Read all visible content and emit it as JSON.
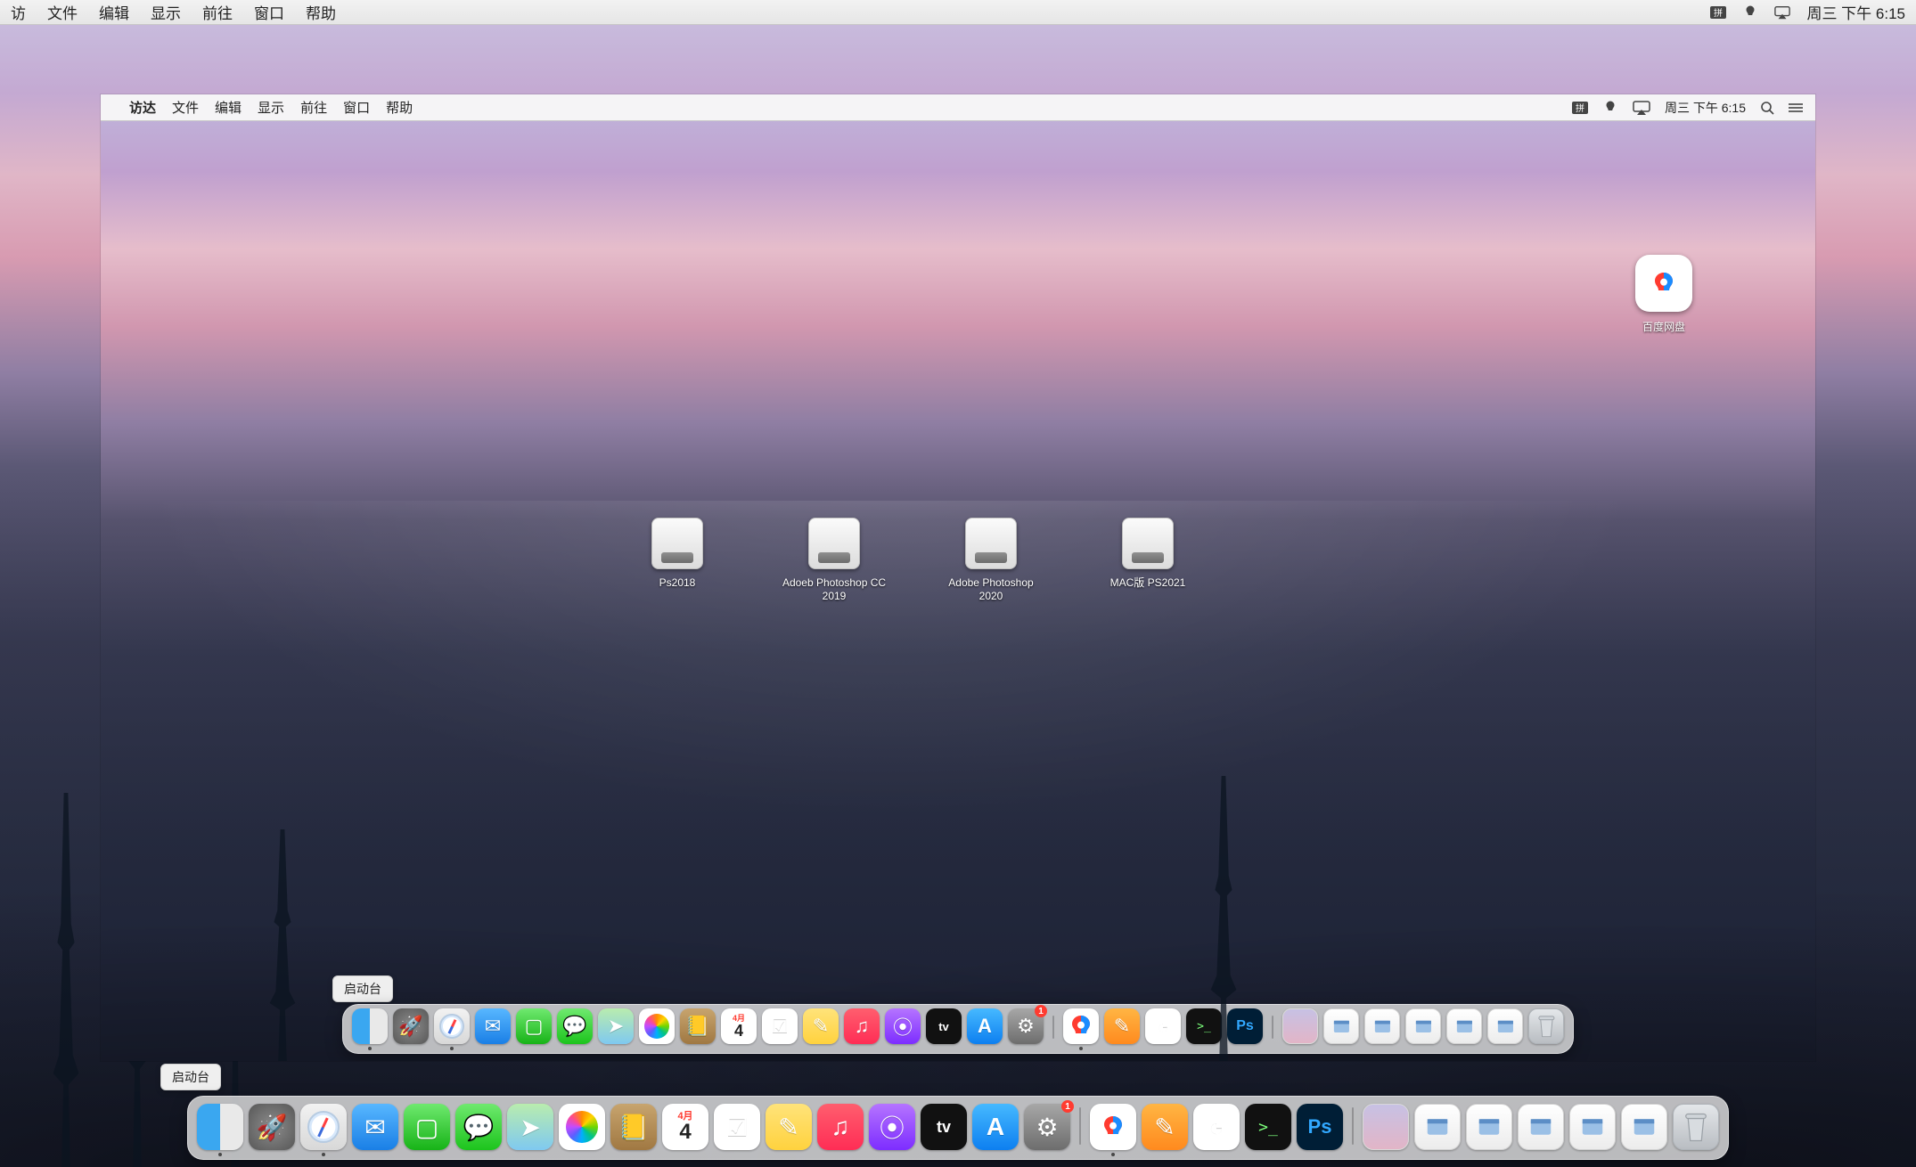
{
  "outer_menubar": {
    "items": [
      "访",
      "文件",
      "编辑",
      "显示",
      "前往",
      "窗口",
      "帮助"
    ],
    "clock": "周三 下午 6:15"
  },
  "inner_menubar": {
    "app": "访达",
    "items": [
      "文件",
      "编辑",
      "显示",
      "前往",
      "窗口",
      "帮助"
    ],
    "clock": "周三 下午 6:15"
  },
  "desktop_dmgs": [
    {
      "label": "Ps2018"
    },
    {
      "label": "Adoeb Photoshop CC 2019"
    },
    {
      "label": "Adobe Photoshop 2020"
    },
    {
      "label": "MAC版 PS2021"
    }
  ],
  "corner_app": {
    "label": "百度网盘"
  },
  "calendar": {
    "month": "4月",
    "day": "4"
  },
  "inner_dock_tooltip": "启动台",
  "sysprefs_badge": "1",
  "dock_apps_inner": [
    {
      "name": "finder",
      "cls": "c-finder",
      "running": true
    },
    {
      "name": "launchpad",
      "cls": "c-launch",
      "glyph": "🚀"
    },
    {
      "name": "safari",
      "cls": "c-safari",
      "compass": true,
      "running": true
    },
    {
      "name": "mail",
      "cls": "c-mail",
      "glyph": "✉"
    },
    {
      "name": "facetime",
      "cls": "c-facetime",
      "glyph": "▢"
    },
    {
      "name": "messages",
      "cls": "c-messages",
      "glyph": "💬"
    },
    {
      "name": "maps",
      "cls": "c-maps",
      "glyph": "➤"
    },
    {
      "name": "photos",
      "cls": "c-photos",
      "flower": true
    },
    {
      "name": "contacts",
      "cls": "c-contacts",
      "glyph": "📒"
    },
    {
      "name": "calendar",
      "cls": "c-calendar",
      "calendar": true
    },
    {
      "name": "reminders",
      "cls": "c-reminders",
      "glyph": "☑"
    },
    {
      "name": "notes",
      "cls": "c-notes",
      "glyph": "✎"
    },
    {
      "name": "music",
      "cls": "c-music",
      "glyph": "♫"
    },
    {
      "name": "podcasts",
      "cls": "c-podcasts",
      "glyph": "⦿"
    },
    {
      "name": "tv",
      "cls": "c-tv",
      "glyph": "tv"
    },
    {
      "name": "appstore",
      "cls": "c-appstore",
      "glyph": "A"
    },
    {
      "name": "system-preferences",
      "cls": "c-prefs",
      "glyph": "⚙",
      "badge": "1"
    }
  ],
  "dock_apps_inner_extra": [
    {
      "name": "baidu-netdisk",
      "cls": "c-baidu",
      "baidu": true,
      "running": true
    },
    {
      "name": "pages",
      "cls": "c-pages",
      "glyph": "✎"
    },
    {
      "name": "clock-app",
      "cls": "c-clock",
      "glyph": "◔"
    },
    {
      "name": "terminal",
      "cls": "c-terminal",
      "glyph": ">_"
    },
    {
      "name": "photoshop",
      "cls": "c-ps",
      "glyph": "Ps"
    }
  ],
  "dock_files_inner": [
    {
      "name": "recent-file-1"
    },
    {
      "name": "recent-file-2"
    },
    {
      "name": "recent-file-3"
    },
    {
      "name": "recent-file-4"
    },
    {
      "name": "recent-file-5"
    }
  ],
  "outer_dock_tooltip": "启动台"
}
